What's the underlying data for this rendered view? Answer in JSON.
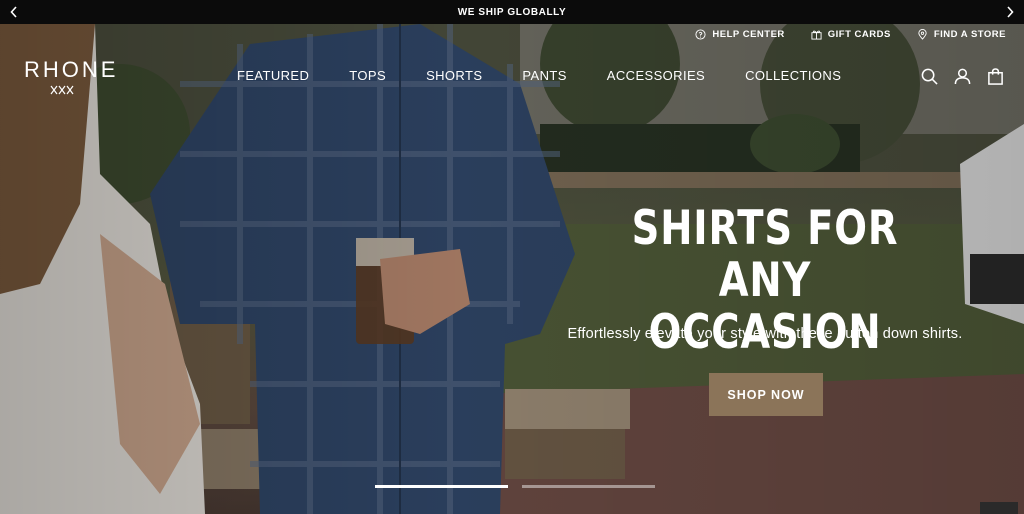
{
  "announcement": {
    "message": "WE SHIP GLOBALLY",
    "prev_icon": "chevron-left-icon",
    "next_icon": "chevron-right-icon"
  },
  "brand": {
    "logo_text": "RHONE"
  },
  "utility_links": [
    {
      "label": "HELP CENTER",
      "icon": "help-circle-icon"
    },
    {
      "label": "GIFT CARDS",
      "icon": "gift-icon"
    },
    {
      "label": "FIND A STORE",
      "icon": "location-pin-icon"
    }
  ],
  "nav": [
    {
      "label": "FEATURED"
    },
    {
      "label": "TOPS"
    },
    {
      "label": "SHORTS"
    },
    {
      "label": "PANTS"
    },
    {
      "label": "ACCESSORIES"
    },
    {
      "label": "COLLECTIONS"
    }
  ],
  "header_icons": [
    "search-icon",
    "account-icon",
    "shopping-bag-icon"
  ],
  "hero": {
    "headline_line1": "SHIRTS FOR ANY",
    "headline_line2": "OCCASION",
    "subtext": "Effortlessly elevate your style with these button down shirts.",
    "cta_label": "SHOP NOW",
    "slides_total": 2,
    "slide_active": 1
  },
  "colors": {
    "announcement_bg": "#0b0b0b",
    "cta_bg": "#8b7459",
    "text": "#ffffff"
  }
}
